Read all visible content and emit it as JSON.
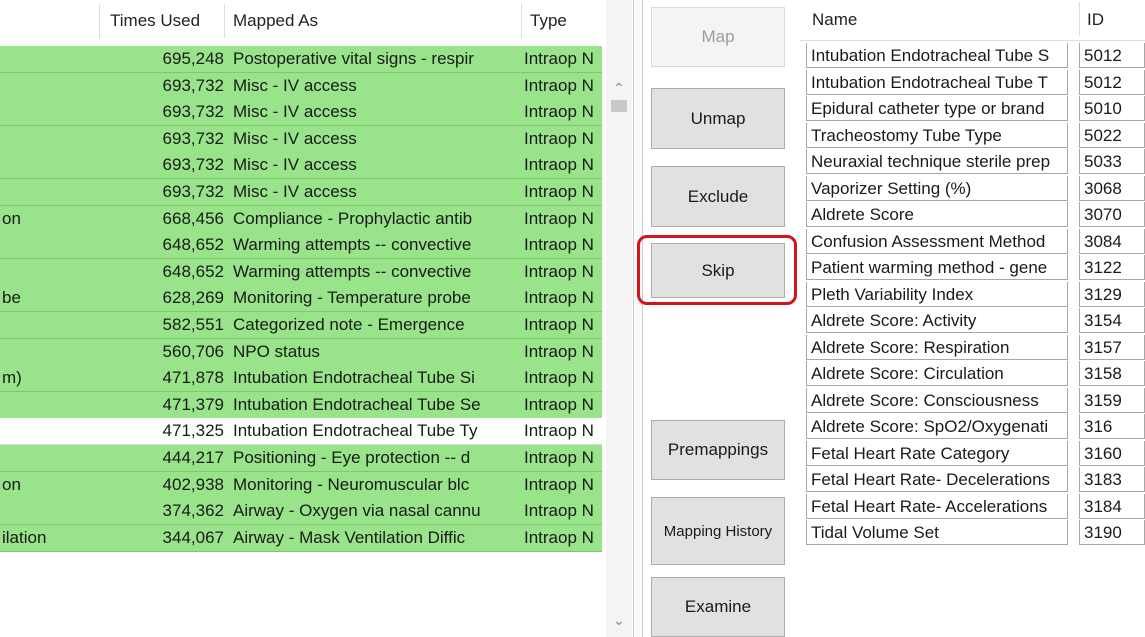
{
  "left_table": {
    "columns": [
      "Times Used",
      "Mapped As",
      "Type"
    ],
    "rows": [
      {
        "name": "",
        "times": "695,248",
        "mapped": "Postoperative vital signs - respir",
        "type": "Intraop N"
      },
      {
        "name": "",
        "times": "693,732",
        "mapped": "Misc - IV access",
        "type": "Intraop N"
      },
      {
        "name": "",
        "times": "693,732",
        "mapped": "Misc - IV access",
        "type": "Intraop N"
      },
      {
        "name": "",
        "times": "693,732",
        "mapped": "Misc - IV access",
        "type": "Intraop N"
      },
      {
        "name": "",
        "times": "693,732",
        "mapped": "Misc - IV access",
        "type": "Intraop N"
      },
      {
        "name": "",
        "times": "693,732",
        "mapped": "Misc - IV access",
        "type": "Intraop N"
      },
      {
        "name": "on",
        "times": "668,456",
        "mapped": "Compliance - Prophylactic antib",
        "type": "Intraop N"
      },
      {
        "name": "",
        "times": "648,652",
        "mapped": "Warming attempts -- convective",
        "type": "Intraop N"
      },
      {
        "name": "",
        "times": "648,652",
        "mapped": "Warming attempts -- convective",
        "type": "Intraop N"
      },
      {
        "name": "be",
        "times": "628,269",
        "mapped": "Monitoring - Temperature probe",
        "type": "Intraop N"
      },
      {
        "name": "",
        "times": "582,551",
        "mapped": "Categorized note - Emergence",
        "type": "Intraop N"
      },
      {
        "name": "",
        "times": "560,706",
        "mapped": "NPO status",
        "type": "Intraop N"
      },
      {
        "name": "m)",
        "times": "471,878",
        "mapped": "Intubation Endotracheal Tube Si",
        "type": "Intraop N"
      },
      {
        "name": "",
        "times": "471,379",
        "mapped": "Intubation Endotracheal Tube Se",
        "type": "Intraop N"
      },
      {
        "name": "",
        "times": "471,325",
        "mapped": "Intubation Endotracheal Tube Ty",
        "type": "Intraop N",
        "selected": true
      },
      {
        "name": "",
        "times": "444,217",
        "mapped": "Positioning - Eye protection -- d",
        "type": "Intraop N"
      },
      {
        "name": "on",
        "times": "402,938",
        "mapped": "Monitoring - Neuromuscular blc",
        "type": "Intraop N"
      },
      {
        "name": "",
        "times": "374,362",
        "mapped": "Airway - Oxygen via nasal cannu",
        "type": "Intraop N"
      },
      {
        "name": "ilation",
        "times": "344,067",
        "mapped": "Airway - Mask Ventilation Diffic",
        "type": "Intraop N"
      }
    ]
  },
  "buttons": {
    "map": "Map",
    "unmap": "Unmap",
    "exclude": "Exclude",
    "skip": "Skip",
    "premappings": "Premappings",
    "mapping_history": "Mapping History",
    "examine": "Examine"
  },
  "right_table": {
    "columns": [
      "Name",
      "ID"
    ],
    "rows": [
      {
        "name": "Intubation Endotracheal Tube S",
        "id": "5012"
      },
      {
        "name": "Intubation Endotracheal Tube T",
        "id": "5012"
      },
      {
        "name": "Epidural catheter type or brand",
        "id": "5010"
      },
      {
        "name": "Tracheostomy Tube Type",
        "id": "5022"
      },
      {
        "name": "Neuraxial technique sterile prep",
        "id": "5033"
      },
      {
        "name": "Vaporizer Setting (%)",
        "id": "3068"
      },
      {
        "name": "Aldrete Score",
        "id": "3070"
      },
      {
        "name": "Confusion Assessment Method",
        "id": "3084"
      },
      {
        "name": "Patient warming method - gene",
        "id": "3122"
      },
      {
        "name": "Pleth Variability Index",
        "id": "3129"
      },
      {
        "name": "Aldrete Score: Activity",
        "id": "3154"
      },
      {
        "name": "Aldrete Score: Respiration",
        "id": "3157"
      },
      {
        "name": "Aldrete Score: Circulation",
        "id": "3158"
      },
      {
        "name": "Aldrete Score: Consciousness",
        "id": "3159"
      },
      {
        "name": "Aldrete Score: SpO2/Oxygenati",
        "id": "316"
      },
      {
        "name": "Fetal Heart Rate Category",
        "id": "3160"
      },
      {
        "name": "Fetal Heart Rate- Decelerations",
        "id": "3183"
      },
      {
        "name": "Fetal Heart Rate- Accelerations",
        "id": "3184"
      },
      {
        "name": "Tidal Volume Set",
        "id": "3190"
      }
    ]
  },
  "colors": {
    "mapped_row": "#99e38a",
    "selected_row": "#ffffff",
    "highlight": "#d4141c"
  }
}
